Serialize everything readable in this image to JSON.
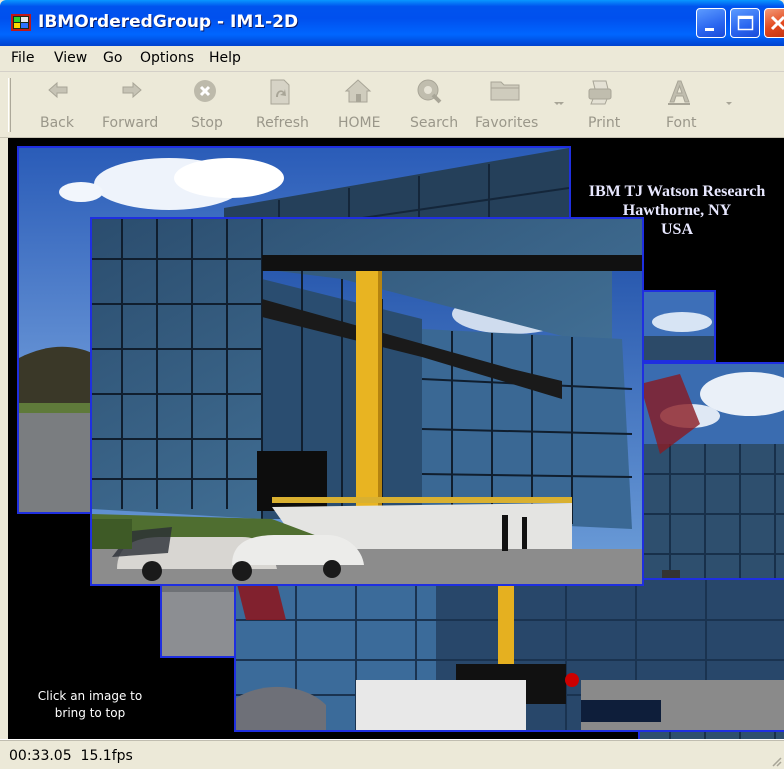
{
  "window": {
    "title": "IBMOrderedGroup - IM1-2D",
    "icon": "app-window-icon",
    "controls": [
      "minimize",
      "maximize",
      "close"
    ]
  },
  "menu": [
    "File",
    "View",
    "Go",
    "Options",
    "Help"
  ],
  "toolbar": {
    "back": {
      "label": "Back",
      "icon": "back-arrow-icon"
    },
    "forward": {
      "label": "Forward",
      "icon": "forward-arrow-icon"
    },
    "stop": {
      "label": "Stop",
      "icon": "stop-icon"
    },
    "refresh": {
      "label": "Refresh",
      "icon": "refresh-icon"
    },
    "home": {
      "label": "HOME",
      "icon": "home-icon"
    },
    "search": {
      "label": "Search",
      "icon": "search-icon"
    },
    "favorites": {
      "label": "Favorites",
      "icon": "folder-icon"
    },
    "print": {
      "label": "Print",
      "icon": "printer-icon"
    },
    "font": {
      "label": "Font",
      "icon": "font-icon"
    }
  },
  "viewer": {
    "info_lines": [
      "IBM TJ Watson Research",
      "Hawthorne, NY",
      "USA"
    ],
    "hint_lines": [
      "Click an image to",
      "bring to top"
    ],
    "photos": [
      "building-photo-back-left",
      "building-photo-right",
      "building-photo-strip",
      "building-photo-bottom",
      "building-photo-front"
    ]
  },
  "status": {
    "time": "00:33.05",
    "fps": "15.1fps"
  },
  "colors": {
    "titlebar": "#0053ee",
    "photo_border": "#1f2fe0",
    "viewport": "#000000",
    "chrome": "#ece9d8"
  }
}
